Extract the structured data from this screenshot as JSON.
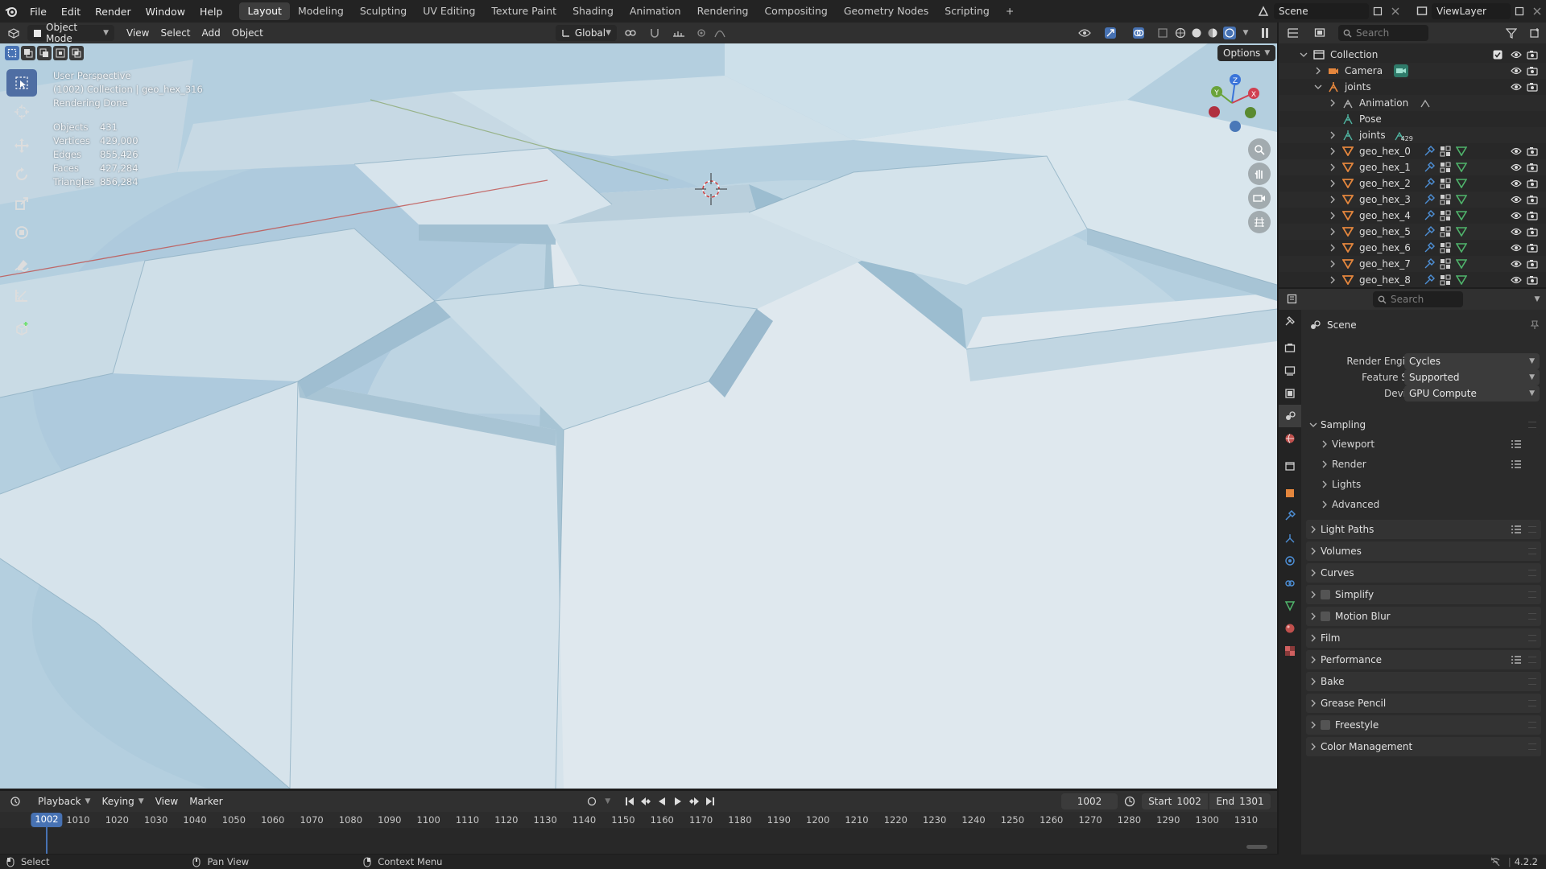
{
  "topbar": {
    "menus": [
      "File",
      "Edit",
      "Render",
      "Window",
      "Help"
    ],
    "workspaces": [
      "Layout",
      "Modeling",
      "Sculpting",
      "UV Editing",
      "Texture Paint",
      "Shading",
      "Animation",
      "Rendering",
      "Compositing",
      "Geometry Nodes",
      "Scripting"
    ],
    "active_workspace": "Layout",
    "add_tab": "+",
    "scene": "Scene",
    "view_layer": "ViewLayer"
  },
  "viewport_header": {
    "mode": "Object Mode",
    "menus": [
      "View",
      "Select",
      "Add",
      "Object"
    ],
    "orientation": "Global",
    "options": "Options"
  },
  "overlay": {
    "perspective": "User Perspective",
    "collection_line": "(1002) Collection | geo_hex_316",
    "status": "Rendering Done",
    "stats": [
      {
        "label": "Objects",
        "value": "431"
      },
      {
        "label": "Vertices",
        "value": "429,000"
      },
      {
        "label": "Edges",
        "value": "855,426"
      },
      {
        "label": "Faces",
        "value": "427,284"
      },
      {
        "label": "Triangles",
        "value": "856,284"
      }
    ]
  },
  "outliner": {
    "search_placeholder": "Search",
    "rows": [
      {
        "label": "Collection",
        "indent": 0,
        "kind": "collection",
        "expanded": true,
        "badge": ""
      },
      {
        "label": "Camera",
        "indent": 1,
        "kind": "camera",
        "expanded": false,
        "badge": ""
      },
      {
        "label": "joints",
        "indent": 1,
        "kind": "armature",
        "expanded": true,
        "badge": ""
      },
      {
        "label": "Animation",
        "indent": 2,
        "kind": "action",
        "expanded": false,
        "badge": ""
      },
      {
        "label": "Pose",
        "indent": 2,
        "kind": "pose",
        "expanded": false,
        "badge": ""
      },
      {
        "label": "joints",
        "indent": 2,
        "kind": "armature-data",
        "expanded": false,
        "badge": "429"
      },
      {
        "label": "geo_hex_0",
        "indent": 2,
        "kind": "mesh",
        "expanded": false,
        "badge": ""
      },
      {
        "label": "geo_hex_1",
        "indent": 2,
        "kind": "mesh",
        "expanded": false,
        "badge": ""
      },
      {
        "label": "geo_hex_2",
        "indent": 2,
        "kind": "mesh",
        "expanded": false,
        "badge": ""
      },
      {
        "label": "geo_hex_3",
        "indent": 2,
        "kind": "mesh",
        "expanded": false,
        "badge": ""
      },
      {
        "label": "geo_hex_4",
        "indent": 2,
        "kind": "mesh",
        "expanded": false,
        "badge": ""
      },
      {
        "label": "geo_hex_5",
        "indent": 2,
        "kind": "mesh",
        "expanded": false,
        "badge": ""
      },
      {
        "label": "geo_hex_6",
        "indent": 2,
        "kind": "mesh",
        "expanded": false,
        "badge": ""
      },
      {
        "label": "geo_hex_7",
        "indent": 2,
        "kind": "mesh",
        "expanded": false,
        "badge": ""
      },
      {
        "label": "geo_hex_8",
        "indent": 2,
        "kind": "mesh",
        "expanded": false,
        "badge": ""
      }
    ]
  },
  "properties": {
    "search_placeholder": "Search",
    "context": "Scene",
    "fields": [
      {
        "label": "Render Engine",
        "value": "Cycles"
      },
      {
        "label": "Feature Set",
        "value": "Supported"
      },
      {
        "label": "Device",
        "value": "GPU Compute"
      }
    ],
    "sampling": {
      "title": "Sampling",
      "children": [
        "Viewport",
        "Render",
        "Lights",
        "Advanced"
      ]
    },
    "panels": [
      {
        "label": "Light Paths",
        "checkbox": false,
        "presets": true
      },
      {
        "label": "Volumes",
        "checkbox": false,
        "presets": false
      },
      {
        "label": "Curves",
        "checkbox": false,
        "presets": false
      },
      {
        "label": "Simplify",
        "checkbox": true,
        "presets": false
      },
      {
        "label": "Motion Blur",
        "checkbox": true,
        "presets": false
      },
      {
        "label": "Film",
        "checkbox": false,
        "presets": false
      },
      {
        "label": "Performance",
        "checkbox": false,
        "presets": true
      },
      {
        "label": "Bake",
        "checkbox": false,
        "presets": false
      },
      {
        "label": "Grease Pencil",
        "checkbox": false,
        "presets": false
      },
      {
        "label": "Freestyle",
        "checkbox": true,
        "presets": false
      },
      {
        "label": "Color Management",
        "checkbox": false,
        "presets": false
      }
    ]
  },
  "timeline": {
    "menus": [
      "Playback",
      "Keying",
      "View",
      "Marker"
    ],
    "current_frame": "1002",
    "start_label": "Start",
    "start": "1002",
    "end_label": "End",
    "end": "1301",
    "ruler": [
      "1010",
      "1020",
      "1030",
      "1040",
      "1050",
      "1060",
      "1070",
      "1080",
      "1090",
      "1100",
      "1110",
      "1120",
      "1130",
      "1140",
      "1150",
      "1160",
      "1170",
      "1180",
      "1190",
      "1200",
      "1210",
      "1220",
      "1230",
      "1240",
      "1250",
      "1260",
      "1270",
      "1280",
      "1290",
      "1300",
      "1310"
    ],
    "playhead": "1002"
  },
  "statusbar": {
    "items": [
      "Select",
      "Pan View",
      "Context Menu"
    ],
    "version": "4.2.2"
  },
  "colors": {
    "accent": "#4772b3",
    "mesh_icon": "#e4863d",
    "viewport_floor": "#b9d0de"
  }
}
